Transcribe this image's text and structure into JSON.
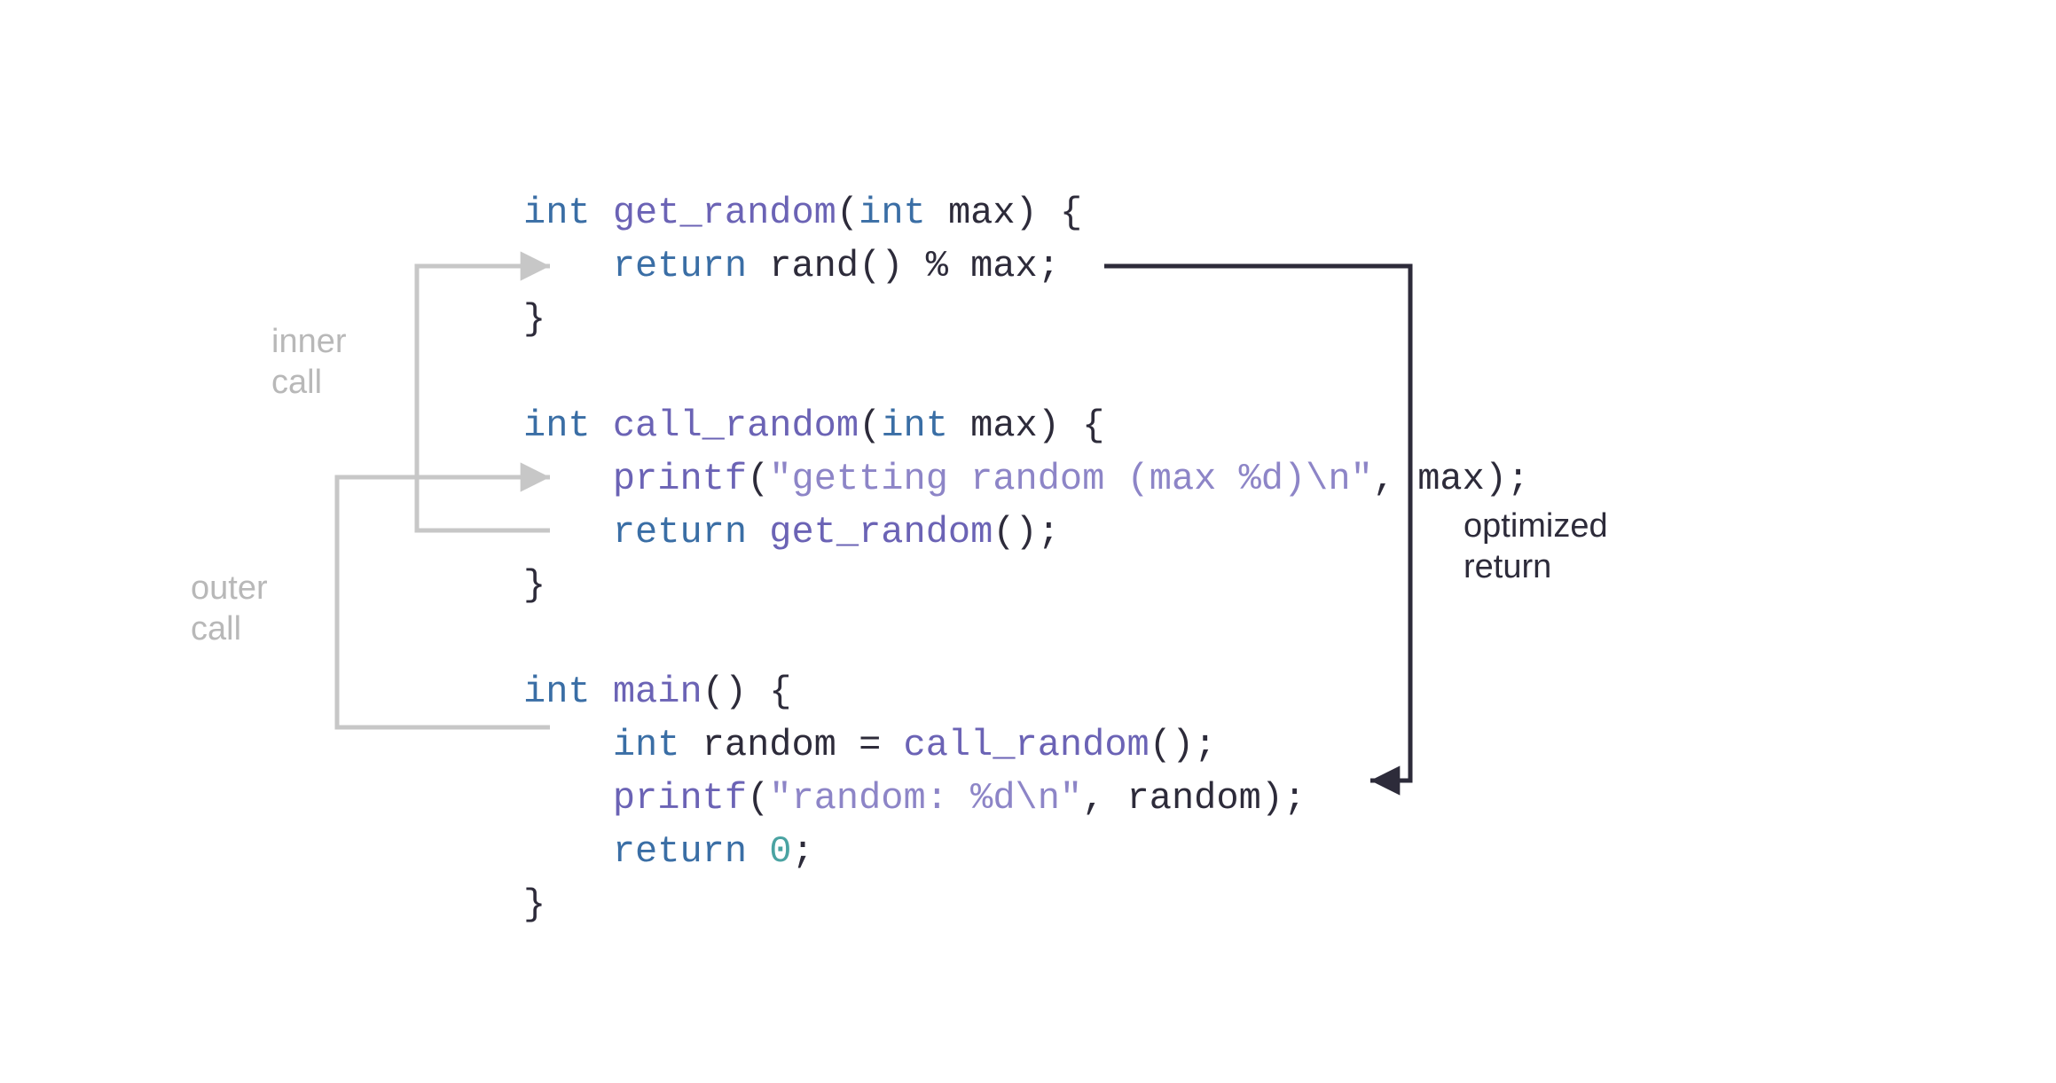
{
  "labels": {
    "inner1": "inner",
    "inner2": "call",
    "outer1": "outer",
    "outer2": "call",
    "opt1": "optimized",
    "opt2": "return"
  },
  "code": {
    "l1_kw1": "int",
    "l1_fn": "get_random",
    "l1_p1": "(",
    "l1_kw2": "int",
    "l1_rest": " max) {",
    "l2_indent": "    ",
    "l2_kw": "return",
    "l2_rest": " rand() % max;",
    "l3": "}",
    "l5_kw1": "int",
    "l5_fn": "call_random",
    "l5_p1": "(",
    "l5_kw2": "int",
    "l5_rest": " max) {",
    "l6_indent": "    ",
    "l6_fn": "printf",
    "l6_p1": "(",
    "l6_str": "\"getting random (max %d)\\n\"",
    "l6_rest": ", max);",
    "l7_indent": "    ",
    "l7_kw": "return",
    "l7_fn": " get_random",
    "l7_rest": "();",
    "l8": "}",
    "l10_kw1": "int",
    "l10_fn": "main",
    "l10_rest": "() {",
    "l11_indent": "    ",
    "l11_kw": "int",
    "l11_txt1": " random = ",
    "l11_fn": "call_random",
    "l11_rest": "();",
    "l12_indent": "    ",
    "l12_fn": "printf",
    "l12_p1": "(",
    "l12_str": "\"random: %d\\n\"",
    "l12_rest": ", random);",
    "l13_indent": "    ",
    "l13_kw": "return",
    "l13_sp": " ",
    "l13_num": "0",
    "l13_rest": ";",
    "l14": "}"
  }
}
